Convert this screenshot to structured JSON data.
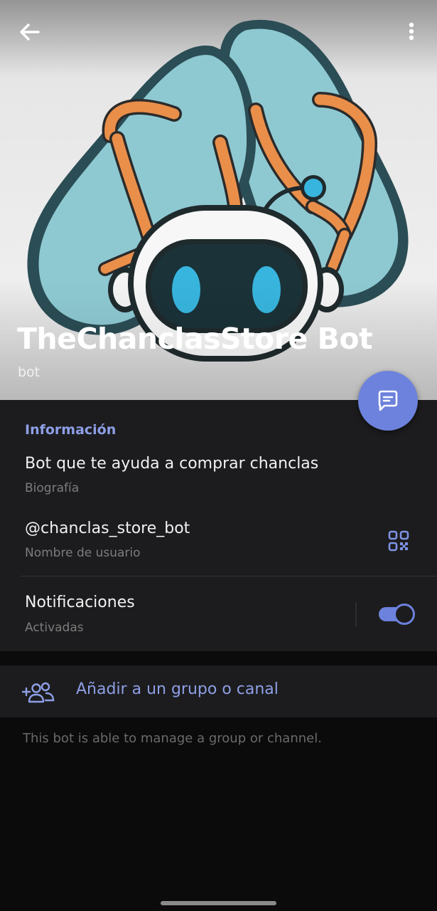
{
  "header": {
    "title": "TheChanclasStore Bot",
    "subtitle": "bot",
    "back_icon": "arrow-left-icon",
    "menu_icon": "more-vertical-icon",
    "fab_icon": "message-icon"
  },
  "info": {
    "section_title": "Información",
    "bio": "Bot que te ayuda a comprar chanclas",
    "bio_label": "Biografía",
    "username": "@chanclas_store_bot",
    "username_label": "Nombre de usuario",
    "qr_icon": "qr-code-icon",
    "notifications": "Notificaciones",
    "notifications_status": "Activadas",
    "notifications_enabled": true
  },
  "actions": {
    "add_to_group": "Añadir a un grupo o canal",
    "add_icon": "add-users-icon"
  },
  "footer_note": "This bot is able to manage a group or channel.",
  "colors": {
    "accent": "#6c82dc",
    "accent_text": "#8e9fe6",
    "panel_bg": "#1c1c1e",
    "page_bg": "#0b0b0b"
  }
}
